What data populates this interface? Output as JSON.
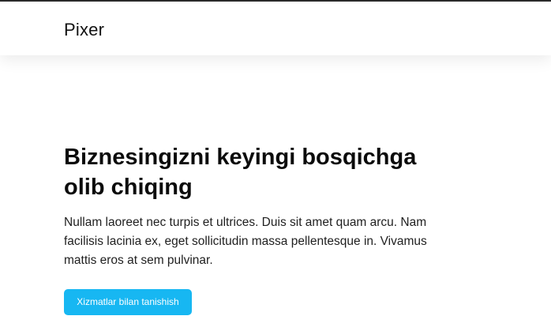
{
  "header": {
    "logo_text": "Pixer"
  },
  "hero": {
    "title": "Biznesingizni keyingi bosqichga olib chiqing",
    "description": "Nullam laoreet nec turpis et ultrices. Duis sit amet quam arcu. Nam facilisis lacinia ex, eget sollicitudin massa pellentesque in. Vivamus mattis eros at sem pulvinar.",
    "cta_label": "Xizmatlar bilan tanishish"
  },
  "colors": {
    "accent": "#17b7f2",
    "text": "#111111",
    "background": "#ffffff"
  }
}
